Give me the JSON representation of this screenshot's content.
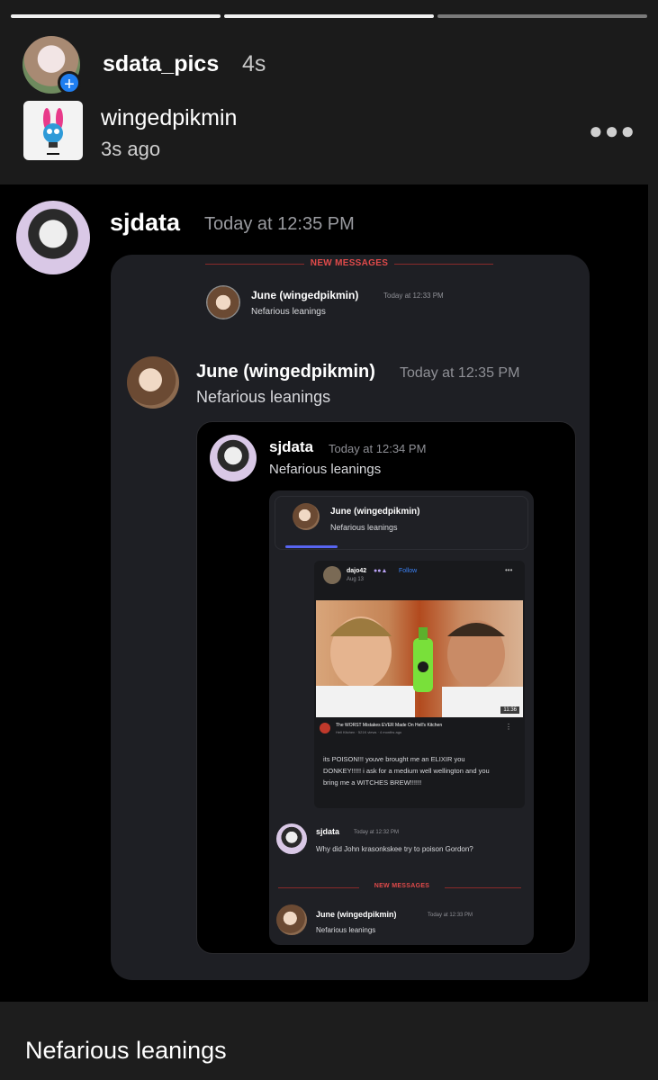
{
  "story": {
    "progress": [
      1,
      1,
      0.0
    ],
    "poster_name": "sdata_pics",
    "poster_time": "4s",
    "repost_name": "wingedpikmin",
    "repost_time": "3s ago",
    "more_icon": "more-horizontal-icon",
    "caption": "Nefarious leanings"
  },
  "outer": {
    "author": "sjdata",
    "time": "Today at 12:35 PM"
  },
  "card1": {
    "new_messages": "NEW MESSAGES",
    "reply_author": "June (wingedpikmin)",
    "reply_time": "Today at 12:33 PM",
    "reply_text": "Nefarious leanings",
    "author": "June (wingedpikmin)",
    "time": "Today at 12:35 PM",
    "text": "Nefarious leanings"
  },
  "card2": {
    "author": "sjdata",
    "time": "Today at 12:34 PM",
    "text": "Nefarious leanings"
  },
  "card3": {
    "quote_author": "June (wingedpikmin)",
    "quote_text": "Nefarious leanings",
    "post_user": "dajo42",
    "post_follow": "Follow",
    "post_date": "Aug 13",
    "video_title": "The WORST Mistakes EVER Made On Hell's Kitchen",
    "video_meta": "Hell Kitchen · 521K views · 4 months ago",
    "duration": "11:36",
    "post_text": "its POISON!!! youve brought me an ELIXIR you DONKEY!!!!! i ask for a medium well wellington and you bring me a WITCHES BREW!!!!!!",
    "msg1_author": "sjdata",
    "msg1_time": "Today at 12:32 PM",
    "msg1_text": "Why did John krasonkskee try to poison Gordon?",
    "new_messages": "NEW MESSAGES",
    "msg2_author": "June (wingedpikmin)",
    "msg2_time": "Today at 12:33 PM",
    "msg2_text": "Nefarious leanings"
  },
  "colors": {
    "new_messages": "#e04a4a",
    "follow": "#3b82f6",
    "plus_badge": "#1f7ef0"
  }
}
